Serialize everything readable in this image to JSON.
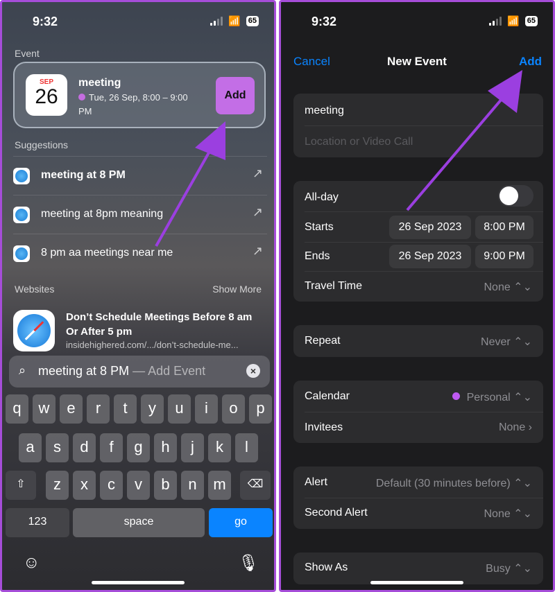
{
  "left": {
    "status": {
      "time": "9:32",
      "battery": "65"
    },
    "event_label": "Event",
    "event": {
      "month": "SEP",
      "day": "26",
      "title": "meeting",
      "time": "Tue, 26 Sep, 8:00 – 9:00 PM",
      "add_label": "Add"
    },
    "suggestions_label": "Suggestions",
    "suggestions": [
      {
        "text": "meeting at 8 PM"
      },
      {
        "text": "meeting at 8pm meaning"
      },
      {
        "text": "8 pm aa meetings near me"
      }
    ],
    "websites_label": "Websites",
    "show_more": "Show More",
    "website": {
      "title": "Don’t Schedule Meetings Before 8 am Or After 5 pm",
      "url": "insidehighered.com/.../don’t-schedule-me..."
    },
    "search": {
      "query": "meeting at 8 PM",
      "suggestion": " — Add Event"
    },
    "keyboard": {
      "row1": [
        "q",
        "w",
        "e",
        "r",
        "t",
        "y",
        "u",
        "i",
        "o",
        "p"
      ],
      "row2": [
        "a",
        "s",
        "d",
        "f",
        "g",
        "h",
        "j",
        "k",
        "l"
      ],
      "row3": [
        "z",
        "x",
        "c",
        "v",
        "b",
        "n",
        "m"
      ],
      "numbers": "123",
      "space": "space",
      "go": "go"
    }
  },
  "right": {
    "status": {
      "time": "9:32",
      "battery": "65"
    },
    "nav": {
      "cancel": "Cancel",
      "title": "New Event",
      "add": "Add"
    },
    "title_value": "meeting",
    "location_placeholder": "Location or Video Call",
    "all_day_label": "All-day",
    "all_day_on": false,
    "starts_label": "Starts",
    "starts_date": "26 Sep 2023",
    "starts_time": "8:00 PM",
    "ends_label": "Ends",
    "ends_date": "26 Sep 2023",
    "ends_time": "9:00 PM",
    "travel_label": "Travel Time",
    "travel_value": "None",
    "repeat_label": "Repeat",
    "repeat_value": "Never",
    "calendar_label": "Calendar",
    "calendar_value": "Personal",
    "invitees_label": "Invitees",
    "invitees_value": "None",
    "alert_label": "Alert",
    "alert_value": "Default (30 minutes before)",
    "second_alert_label": "Second Alert",
    "second_alert_value": "None",
    "show_as_label": "Show As",
    "show_as_value": "Busy"
  },
  "colors": {
    "accent_purple": "#a64dd9",
    "ios_blue": "#0a84ff",
    "annotation_arrow": "#9b3fe0"
  }
}
